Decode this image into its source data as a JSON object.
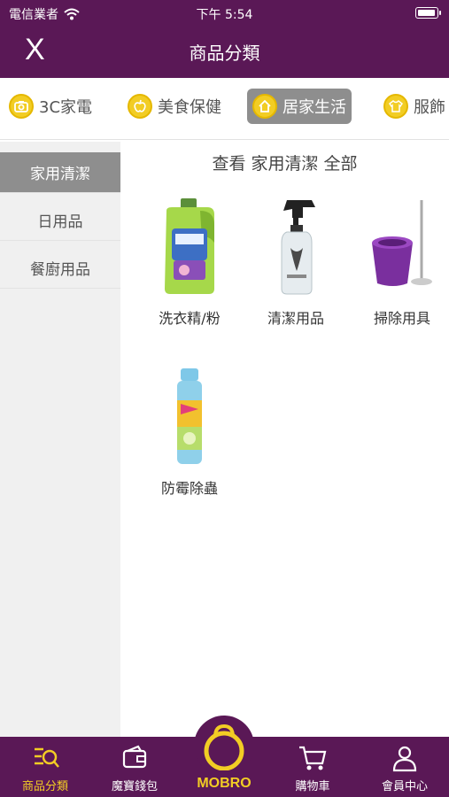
{
  "status_bar": {
    "carrier": "電信業者",
    "time": "下午 5:54"
  },
  "header": {
    "close_label": "X",
    "title": "商品分類"
  },
  "category_tabs": [
    {
      "label": "3C家電",
      "icon": "camera-icon",
      "active": false
    },
    {
      "label": "美食保健",
      "icon": "apple-icon",
      "active": false
    },
    {
      "label": "居家生活",
      "icon": "home-icon",
      "active": true
    },
    {
      "label": "服飾",
      "icon": "shirt-icon",
      "active": false
    }
  ],
  "sidebar": {
    "items": [
      {
        "label": "家用清潔",
        "active": true
      },
      {
        "label": "日用品",
        "active": false
      },
      {
        "label": "餐廚用品",
        "active": false
      }
    ]
  },
  "main": {
    "view_all": "查看 家用清潔 全部",
    "products": [
      {
        "label": "洗衣精/粉",
        "icon": "detergent-bottle-icon"
      },
      {
        "label": "清潔用品",
        "icon": "spray-bottle-icon"
      },
      {
        "label": "掃除用具",
        "icon": "mop-bucket-icon"
      },
      {
        "label": "防霉除蟲",
        "icon": "aerosol-can-icon"
      }
    ]
  },
  "bottom_nav": [
    {
      "label": "商品分類",
      "icon": "category-search-icon",
      "active": true
    },
    {
      "label": "魔寶錢包",
      "icon": "wallet-icon",
      "active": false
    },
    {
      "label": "MOBRO",
      "icon": "mobro-bag-icon",
      "active": false
    },
    {
      "label": "購物車",
      "icon": "cart-icon",
      "active": false
    },
    {
      "label": "會員中心",
      "icon": "member-icon",
      "active": false
    }
  ],
  "colors": {
    "brand_purple": "#5a1856",
    "accent_yellow": "#f2cd24",
    "active_gray": "#8e8e8e"
  }
}
